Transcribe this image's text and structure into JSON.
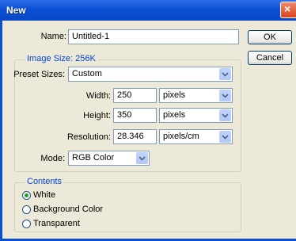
{
  "window": {
    "title": "New",
    "close_glyph": "×"
  },
  "fields": {
    "name_label": "Name:",
    "name_value": "Untitled-1",
    "image_size_label": "Image Size: 256K",
    "preset_label": "Preset Sizes:",
    "preset_value": "Custom",
    "width_label": "Width:",
    "width_value": "250",
    "width_unit": "pixels",
    "height_label": "Height:",
    "height_value": "350",
    "height_unit": "pixels",
    "resolution_label": "Resolution:",
    "resolution_value": "28.346",
    "resolution_unit": "pixels/cm",
    "mode_label": "Mode:",
    "mode_value": "RGB Color"
  },
  "buttons": {
    "ok": "OK",
    "cancel": "Cancel"
  },
  "contents": {
    "title": "Contents",
    "options": [
      "White",
      "Background Color",
      "Transparent"
    ],
    "selected": "White"
  },
  "colors": {
    "titlebar": "#0a4fd4",
    "dialog_bg": "#ece9d8",
    "group_title": "#0046d5"
  }
}
